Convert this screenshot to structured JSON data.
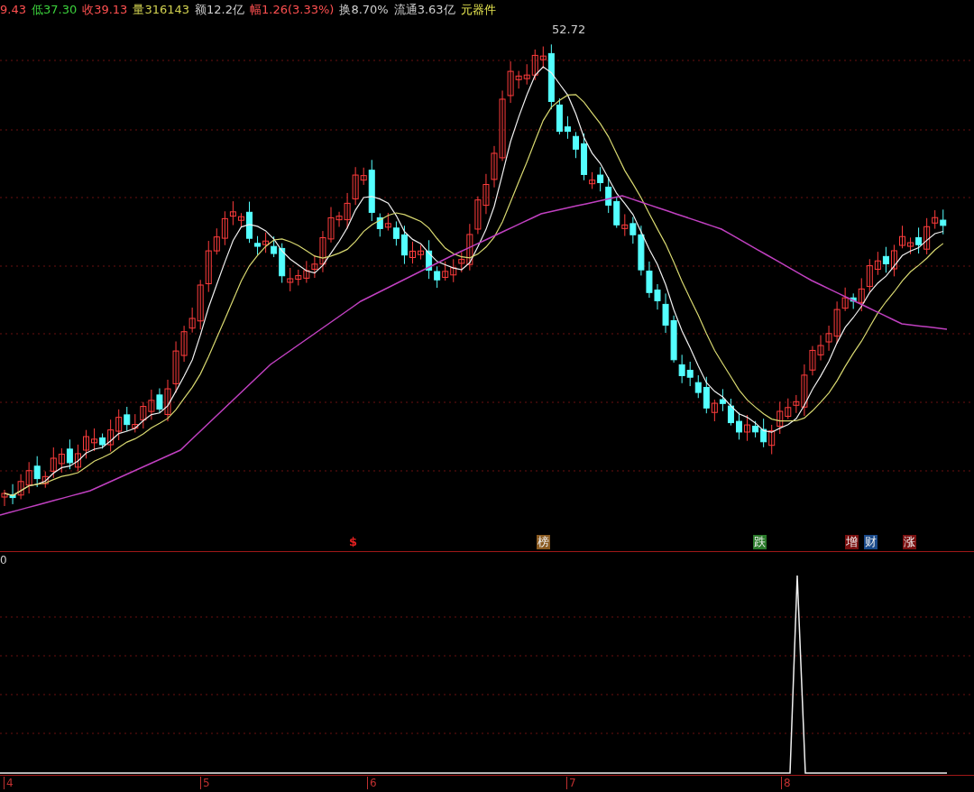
{
  "quote_bar": [
    {
      "text": "9.43",
      "color": "#ff5050"
    },
    {
      "text": "低37.30",
      "color": "#3cd23c"
    },
    {
      "text": "收39.13",
      "color": "#ff5050"
    },
    {
      "text": "量316143",
      "color": "#d2d250"
    },
    {
      "text": "额12.2亿",
      "color": "#d0d0d0"
    },
    {
      "text": "幅1.26(3.33%)",
      "color": "#ff5050"
    },
    {
      "text": "换8.70%",
      "color": "#d0d0d0"
    },
    {
      "text": "流通3.63亿",
      "color": "#d0d0d0"
    },
    {
      "text": "元器件",
      "color": "#e6e650"
    }
  ],
  "price_chart": {
    "high_label": "52.72",
    "signals": [
      {
        "label": "$",
        "kind": "symbol",
        "color": "#e02020"
      },
      {
        "label": "榜",
        "kind": "tag",
        "color": "#8a5a20"
      },
      {
        "label": "跌",
        "kind": "tag",
        "color": "#2a7a2a"
      },
      {
        "label": "增",
        "kind": "tag",
        "color": "#7a1010"
      },
      {
        "label": "财",
        "kind": "tag",
        "color": "#1a4a8a"
      },
      {
        "label": "涨",
        "kind": "tag",
        "color": "#7a1010"
      }
    ]
  },
  "indicator_pane": {
    "zero_label": "0"
  },
  "time_axis": [
    "4",
    "5",
    "6",
    "7",
    "8"
  ]
}
